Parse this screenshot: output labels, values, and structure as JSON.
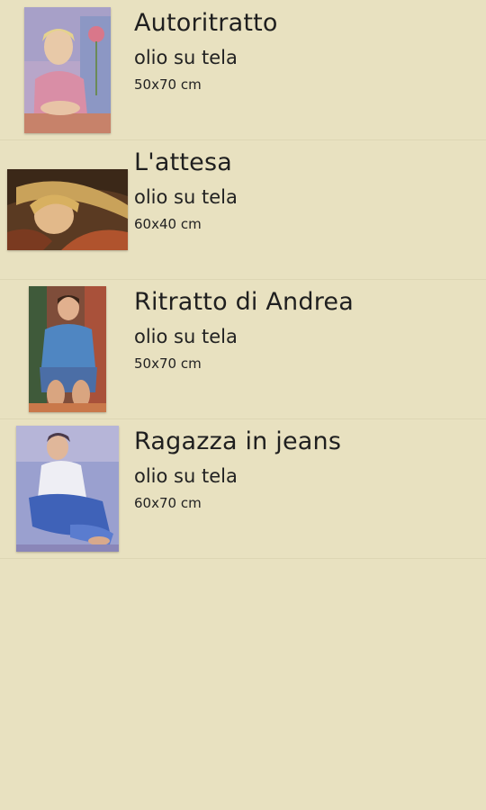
{
  "artworks": [
    {
      "title": "Autoritratto",
      "medium": "olio su tela",
      "size": "50x70 cm"
    },
    {
      "title": "L'attesa",
      "medium": "olio su tela",
      "size": "60x40 cm"
    },
    {
      "title": "Ritratto di Andrea",
      "medium": "olio su tela",
      "size": "50x70 cm"
    },
    {
      "title": "Ragazza in jeans",
      "medium": "olio su tela",
      "size": "60x70 cm"
    }
  ],
  "colors": {
    "background": "#e8e1c0",
    "divider": "#ddd6b4",
    "text": "#1f1f1f"
  }
}
